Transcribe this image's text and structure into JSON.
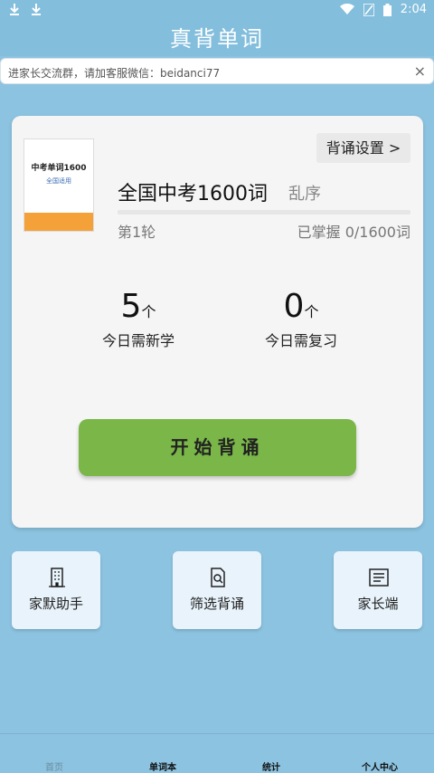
{
  "app": {
    "title": "真背单词"
  },
  "status": {
    "time": "2:04"
  },
  "notice": {
    "text": "进家长交流群，请加客服微信：beidanci77",
    "close": "×"
  },
  "book": {
    "cover_title": "中考单词1600",
    "cover_subtitle": "全国适用",
    "title": "全国中考1600词",
    "order": "乱序",
    "round": "第1轮",
    "mastered": "已掌握 0/1600词",
    "progress": 0
  },
  "settings_label": "背诵设置 >",
  "stats": {
    "new": {
      "value": "5",
      "unit": "个",
      "label": "今日需新学"
    },
    "review": {
      "value": "0",
      "unit": "个",
      "label": "今日需复习"
    }
  },
  "start_label": "开始背诵",
  "actions": [
    {
      "label": "家默助手",
      "icon": "building-icon"
    },
    {
      "label": "筛选背诵",
      "icon": "document-search-icon"
    },
    {
      "label": "家长端",
      "icon": "list-document-icon"
    }
  ],
  "nav": [
    {
      "label": "首页"
    },
    {
      "label": "单词本"
    },
    {
      "label": "统计"
    },
    {
      "label": "个人中心"
    }
  ],
  "colors": {
    "accent": "#7ab648",
    "header": "#83bedd",
    "background": "#8cc3e0",
    "book_band": "#f4a13a"
  }
}
